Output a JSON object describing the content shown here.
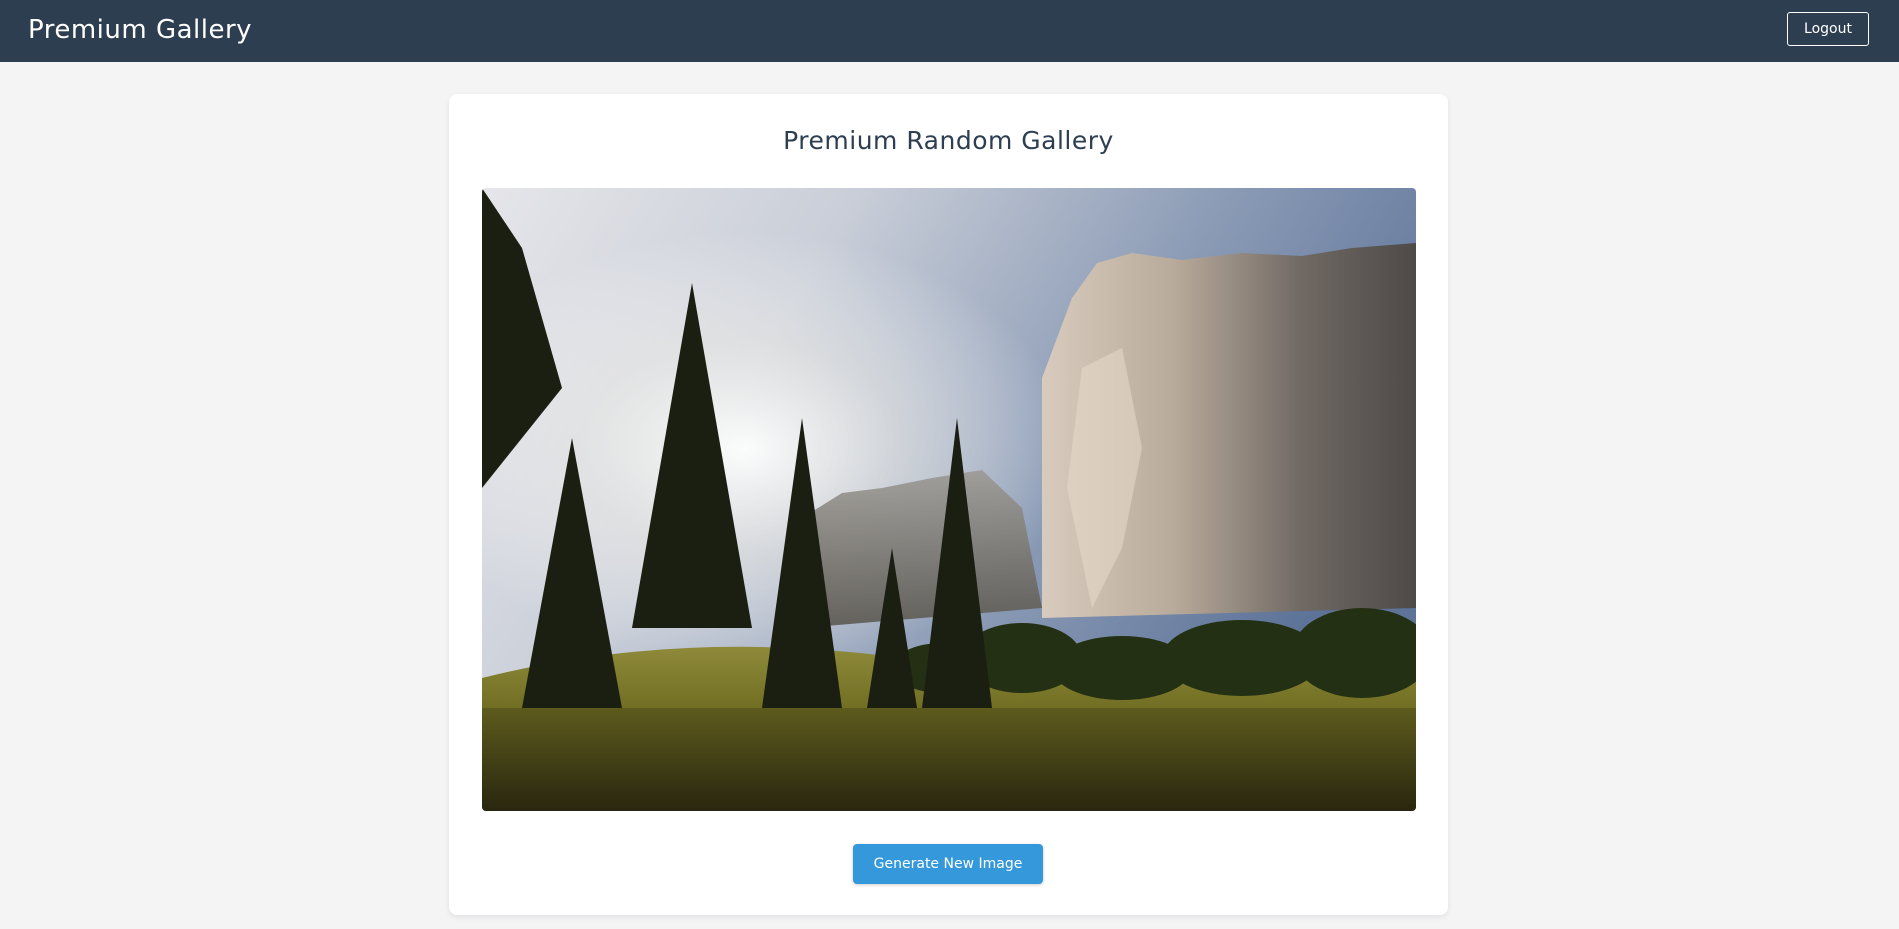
{
  "header": {
    "brand": "Premium Gallery",
    "logout_label": "Logout"
  },
  "main": {
    "title": "Premium Random Gallery",
    "image_alt": "landscape photo",
    "generate_label": "Generate New Image"
  },
  "colors": {
    "header_bg": "#2d3e50",
    "page_bg": "#f4f4f5",
    "accent": "#3498db"
  }
}
